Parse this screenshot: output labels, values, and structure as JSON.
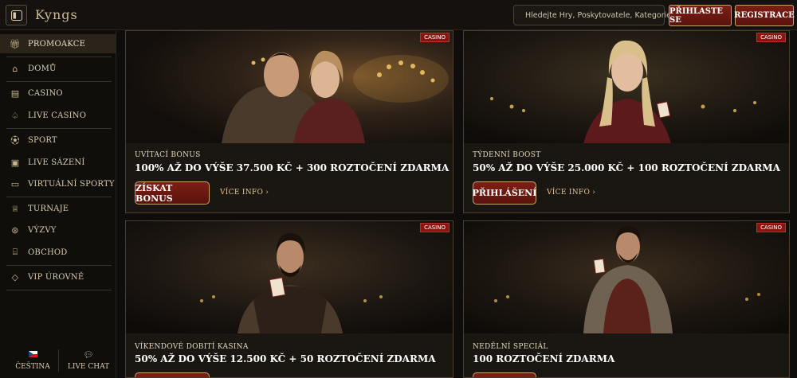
{
  "header": {
    "logo": "Kyngs",
    "search_placeholder": "Hledejte Hry, Poskytovatele, Kategorie",
    "login_label": "Přihlaste se",
    "register_label": "Registrace"
  },
  "sidebar": {
    "items": [
      {
        "label": "Promoakce",
        "icon": "gift-icon"
      },
      {
        "label": "Domů",
        "icon": "home-icon"
      },
      {
        "label": "Casino",
        "icon": "slot-machine-icon"
      },
      {
        "label": "Live Casino",
        "icon": "cards-icon"
      },
      {
        "label": "Sport",
        "icon": "soccer-ball-icon"
      },
      {
        "label": "Live sázení",
        "icon": "live-tv-icon"
      },
      {
        "label": "Virtuální sporty",
        "icon": "virtual-screen-icon"
      },
      {
        "label": "Turnaje",
        "icon": "trophy-icon"
      },
      {
        "label": "Výzvy",
        "icon": "challenge-icon"
      },
      {
        "label": "Obchod",
        "icon": "shop-icon"
      },
      {
        "label": "VIP úrovně",
        "icon": "diamond-icon"
      }
    ],
    "language_label": "Čeština",
    "chat_label": "Live Chat"
  },
  "promos": [
    {
      "tag": "Casino",
      "label": "Uvítací bonus",
      "title": "100% až do výše 37.500 Kč + 300 roztočení zdarma",
      "cta": "Získat bonus",
      "more": "Více info"
    },
    {
      "tag": "Casino",
      "label": "Týdenní Boost",
      "title": "50% až do výše 25.000 Kč + 100 roztočení zdarma",
      "cta": "Přihlášení",
      "more": "Více info"
    },
    {
      "tag": "Casino",
      "label": "Víkendové dobití kasina",
      "title": "50% až do výše 12.500 Kč + 50 roztočení zdarma"
    },
    {
      "tag": "Casino",
      "label": "Nedělní speciál",
      "title": "100 roztočení zdarma"
    }
  ],
  "colors": {
    "accent_red": "#7c1f15",
    "gold": "#c5a46a",
    "background": "#0f0d0b"
  }
}
